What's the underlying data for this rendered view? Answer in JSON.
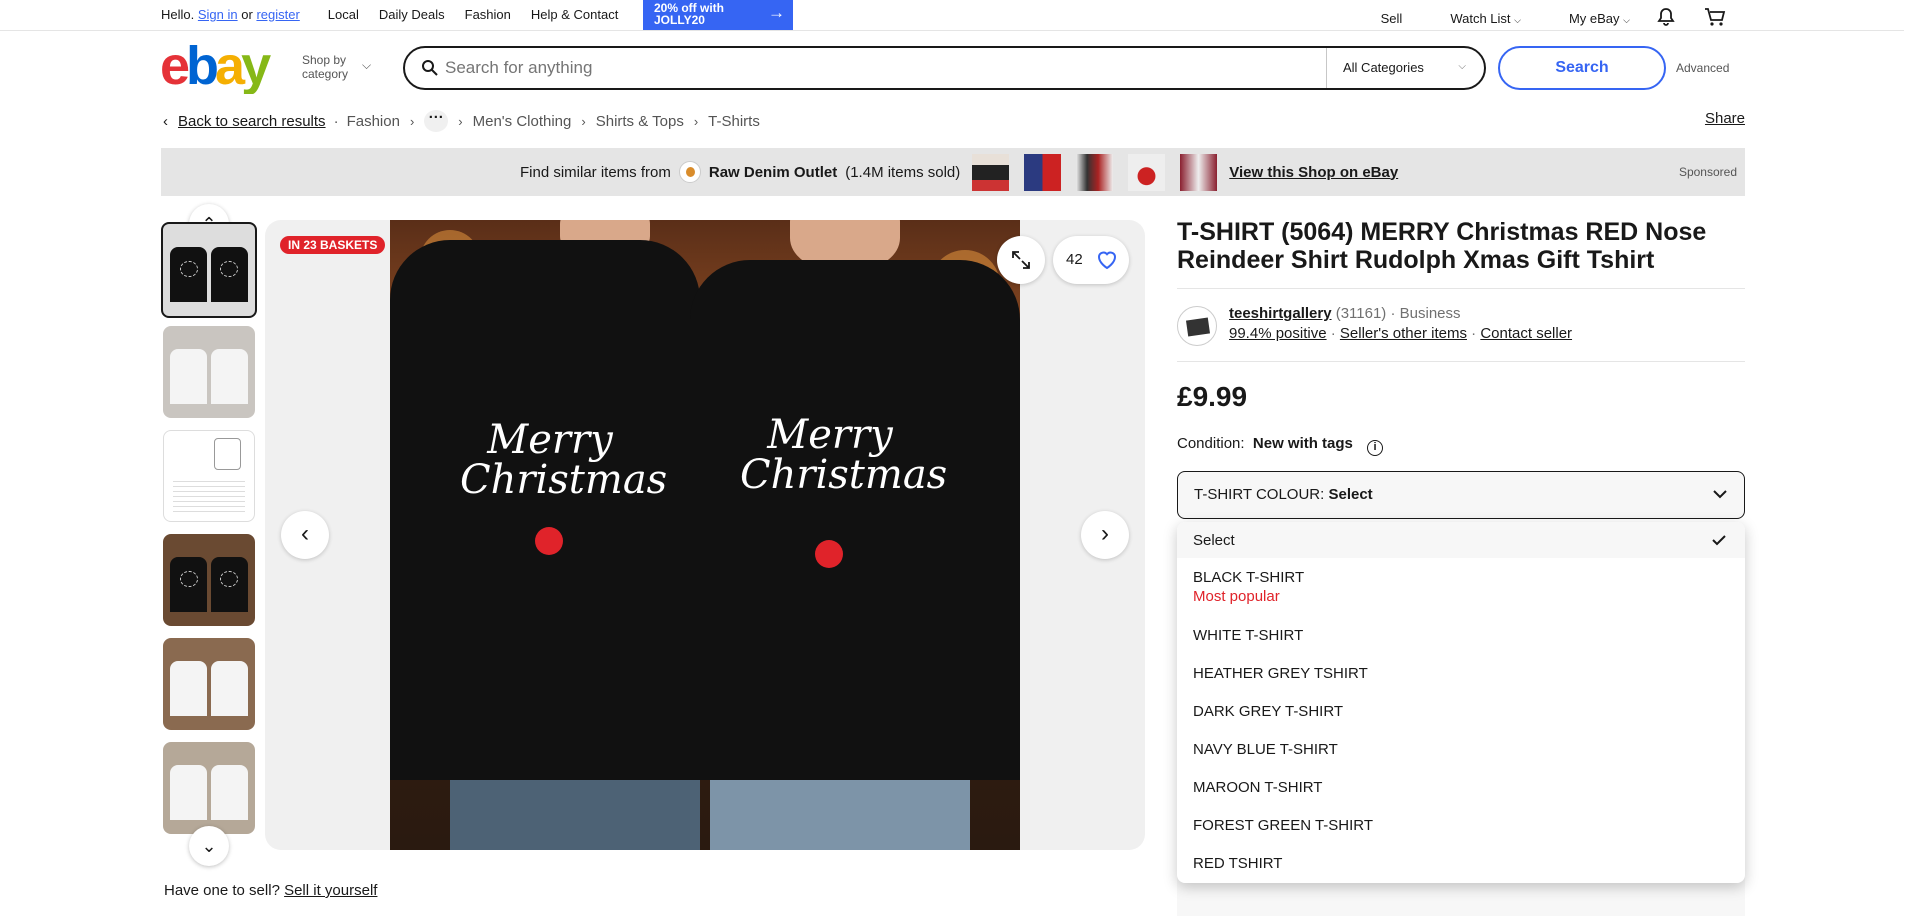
{
  "topnav": {
    "hello": "Hello.",
    "sign_in": "Sign in",
    "or": "or",
    "register": "register",
    "links": [
      "Local",
      "Daily Deals",
      "Fashion",
      "Help & Contact"
    ],
    "promo": "20% off with JOLLY20",
    "right": [
      "Sell",
      "Watch List",
      "My eBay"
    ]
  },
  "header": {
    "logo_letters": [
      "e",
      "b",
      "a",
      "y"
    ],
    "logo_colors": [
      "#e53238",
      "#0064d2",
      "#f5af02",
      "#86b817"
    ],
    "shop_by": "Shop by category",
    "search_placeholder": "Search for anything",
    "category": "All Categories",
    "search_button": "Search",
    "advanced": "Advanced"
  },
  "breadcrumb": {
    "back": "Back to search results",
    "items": [
      "Fashion",
      "Men's Clothing",
      "Shirts & Tops",
      "T-Shirts"
    ],
    "share": "Share"
  },
  "banner": {
    "prefix": "Find similar items from",
    "store": "Raw Denim Outlet",
    "sold": "(1.4M items sold)",
    "cta": "View this Shop on eBay",
    "sponsored": "Sponsored"
  },
  "gallery": {
    "baskets": "IN 23 BASKETS",
    "watchers": "42",
    "sell_prompt": "Have one to sell?",
    "sell_link": "Sell it yourself",
    "print_text": "Merry Christmas"
  },
  "item": {
    "title": "T-SHIRT (5064) MERRY Christmas RED Nose Reindeer Shirt Rudolph Xmas Gift Tshirt",
    "seller_name": "teeshirtgallery",
    "seller_count": "(31161)",
    "seller_type": "Business",
    "positive": "99.4% positive",
    "other_items": "Seller's other items",
    "contact": "Contact seller",
    "price": "£9.99",
    "condition_label": "Condition:",
    "condition_value": "New with tags",
    "select_label": "T-SHIRT COLOUR:",
    "select_value": "Select"
  },
  "dropdown": {
    "options": [
      {
        "label": "Select",
        "note": ""
      },
      {
        "label": "BLACK T-SHIRT",
        "note": "Most popular"
      },
      {
        "label": "WHITE T-SHIRT",
        "note": ""
      },
      {
        "label": "HEATHER GREY TSHIRT",
        "note": ""
      },
      {
        "label": "DARK GREY T-SHIRT",
        "note": ""
      },
      {
        "label": "NAVY BLUE T-SHIRT",
        "note": ""
      },
      {
        "label": "MAROON T-SHIRT",
        "note": ""
      },
      {
        "label": "FOREST GREEN T-SHIRT",
        "note": ""
      },
      {
        "label": "RED TSHIRT",
        "note": ""
      }
    ]
  },
  "colors": {
    "accent": "#3665f3",
    "alert": "#e0232a"
  }
}
